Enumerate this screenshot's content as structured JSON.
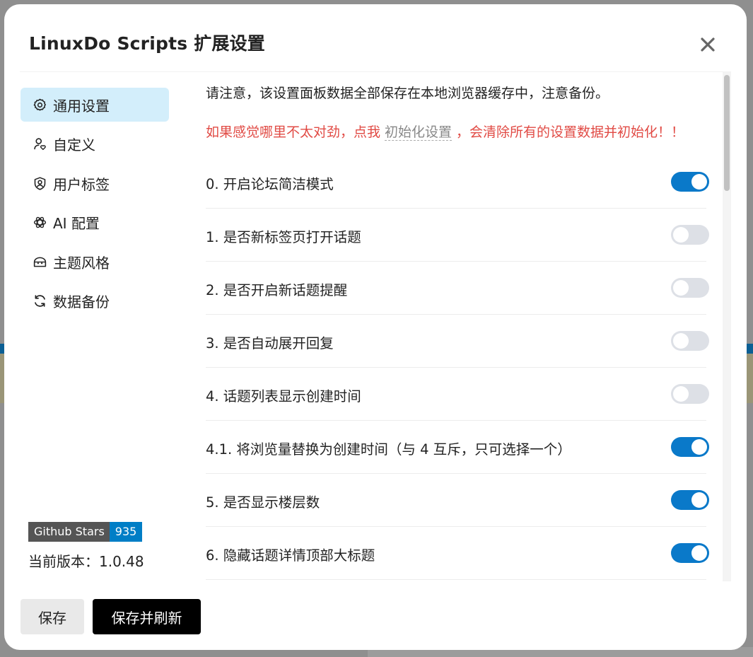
{
  "modal": {
    "title": "LinuxDo Scripts 扩展设置"
  },
  "sidebar": {
    "items": [
      {
        "label": "通用设置",
        "icon": "gear-icon",
        "active": true
      },
      {
        "label": "自定义",
        "icon": "user-heart-icon",
        "active": false
      },
      {
        "label": "用户标签",
        "icon": "user-badge-icon",
        "active": false
      },
      {
        "label": "AI 配置",
        "icon": "ai-knot-icon",
        "active": false
      },
      {
        "label": "主题风格",
        "icon": "theme-icon",
        "active": false
      },
      {
        "label": "数据备份",
        "icon": "refresh-icon",
        "active": false
      }
    ],
    "badge": {
      "label": "Github Stars",
      "count": "935"
    },
    "version": "当前版本：1.0.48"
  },
  "content": {
    "notice": "请注意，该设置面板数据全部保存在本地浏览器缓存中，注意备份。",
    "warning_before": "如果感觉哪里不太对劲，点我",
    "warning_link": "初始化设置",
    "warning_after": "，会清除所有的设置数据并初始化！！"
  },
  "settings": [
    {
      "label": "0. 开启论坛简洁模式",
      "enabled": true
    },
    {
      "label": "1. 是否新标签页打开话题",
      "enabled": false
    },
    {
      "label": "2. 是否开启新话题提醒",
      "enabled": false
    },
    {
      "label": "3. 是否自动展开回复",
      "enabled": false
    },
    {
      "label": "4. 话题列表显示创建时间",
      "enabled": false
    },
    {
      "label": "4.1. 将浏览量替换为创建时间（与 4 互斥，只可选择一个）",
      "enabled": true
    },
    {
      "label": "5. 是否显示楼层数",
      "enabled": true
    },
    {
      "label": "6. 隐藏话题详情顶部大标题",
      "enabled": true
    }
  ],
  "footer": {
    "save_label": "保存",
    "save_refresh_label": "保存并刷新"
  },
  "colors": {
    "accent": "#0a79c9",
    "active_nav": "#d3eefb",
    "warning": "#e14b45"
  }
}
